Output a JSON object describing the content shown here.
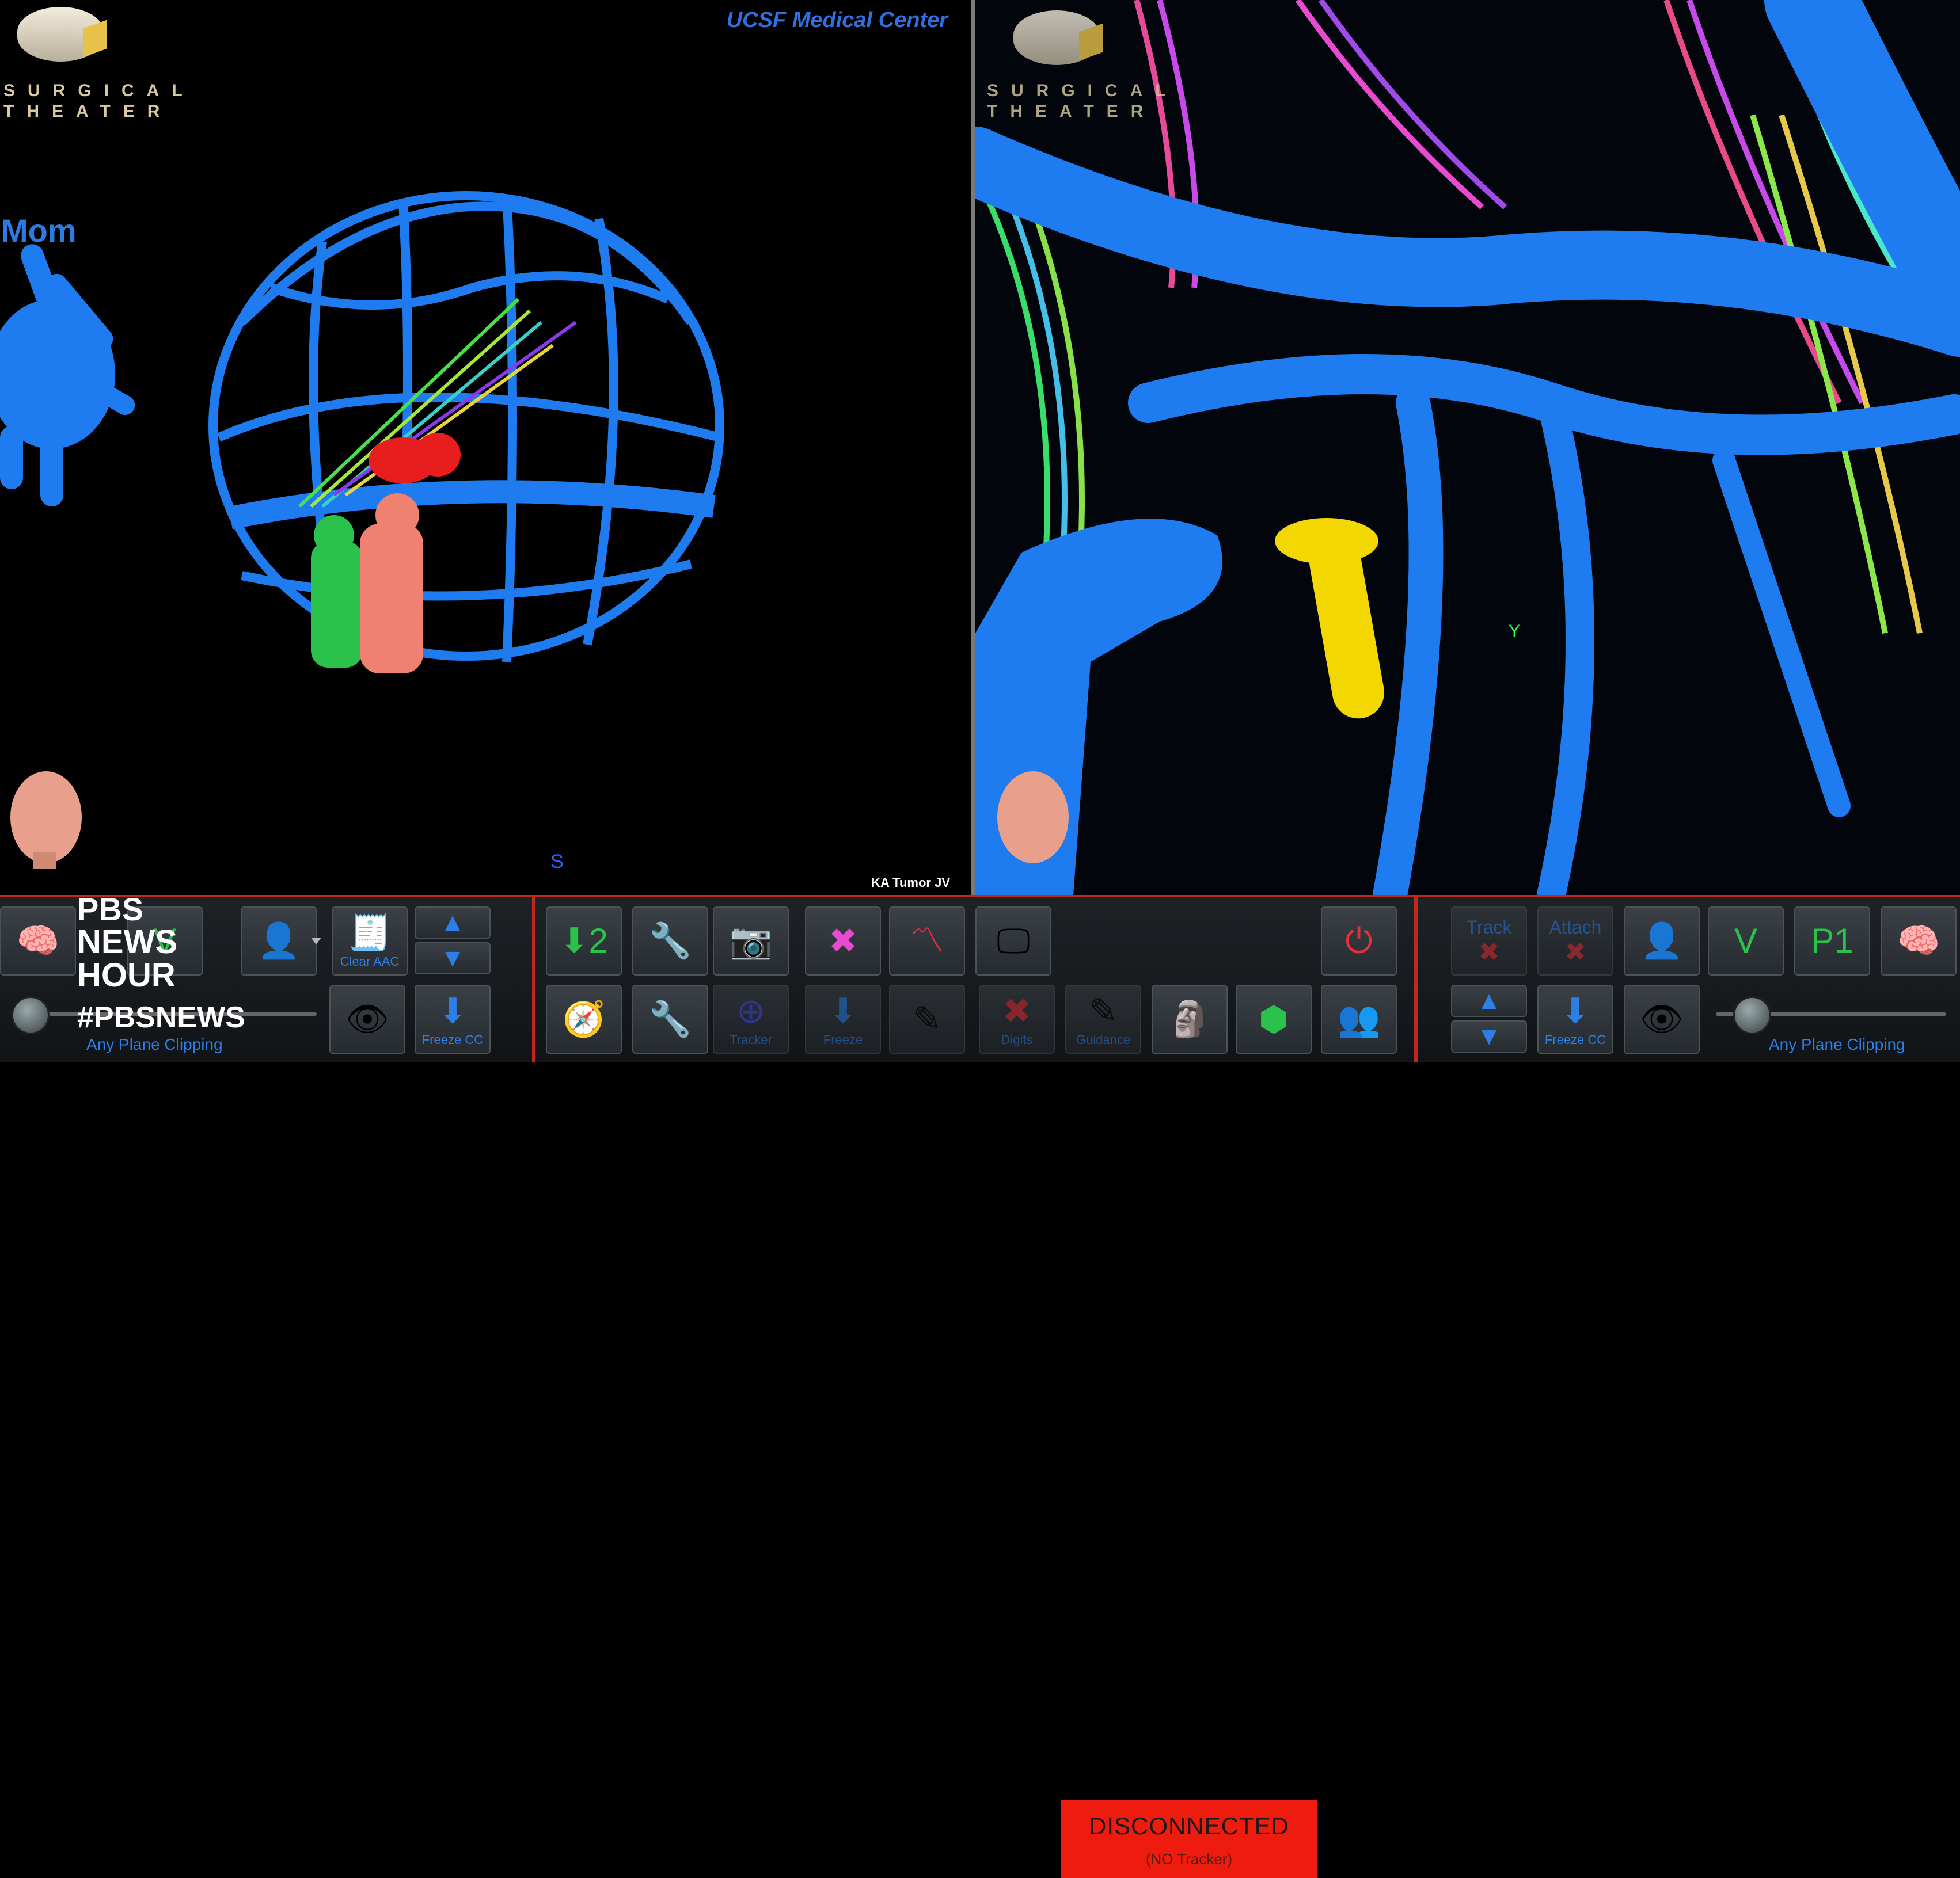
{
  "left_view": {
    "brand": {
      "line1": "SURGICAL",
      "line2": "THEATER"
    },
    "header_right": "UCSF Medical Center",
    "avatar_label": "Mom",
    "caption": "KA Tumor JV",
    "axis_marker": "S"
  },
  "right_view": {
    "brand": {
      "line1": "SURGICAL",
      "line2": "THEATER"
    },
    "axis_marker": "Y"
  },
  "toolbar": {
    "clear_aac_label": "Clear AAC",
    "freeze_cc_label": "Freeze CC",
    "any_plane_clipping_label": "Any Plane Clipping",
    "tracker_label": "Tracker",
    "freeze_label": "Freeze",
    "digits_label": "Digits",
    "guidance_label": "Guidance",
    "status_main": "DISCONNECTED",
    "status_sub": "(NO Tracker)",
    "track_label": "Track",
    "attach_label": "Attach",
    "v_label": "V",
    "p1_label": "P1",
    "step_label": "2",
    "freeze_cc_right_label": "Freeze CC",
    "any_plane_clipping_right_label": "Any Plane Clipping"
  },
  "overlay": {
    "network_line1": "PBS",
    "network_line2": "NEWS",
    "network_line3": "HOUR",
    "hashtag": "#PBSNEWS"
  },
  "colors": {
    "vessel_blue": "#1e7cf0",
    "alert_red": "#ee1b0f",
    "accent_label": "#2d7fe8",
    "divider_red": "#c0271d"
  }
}
